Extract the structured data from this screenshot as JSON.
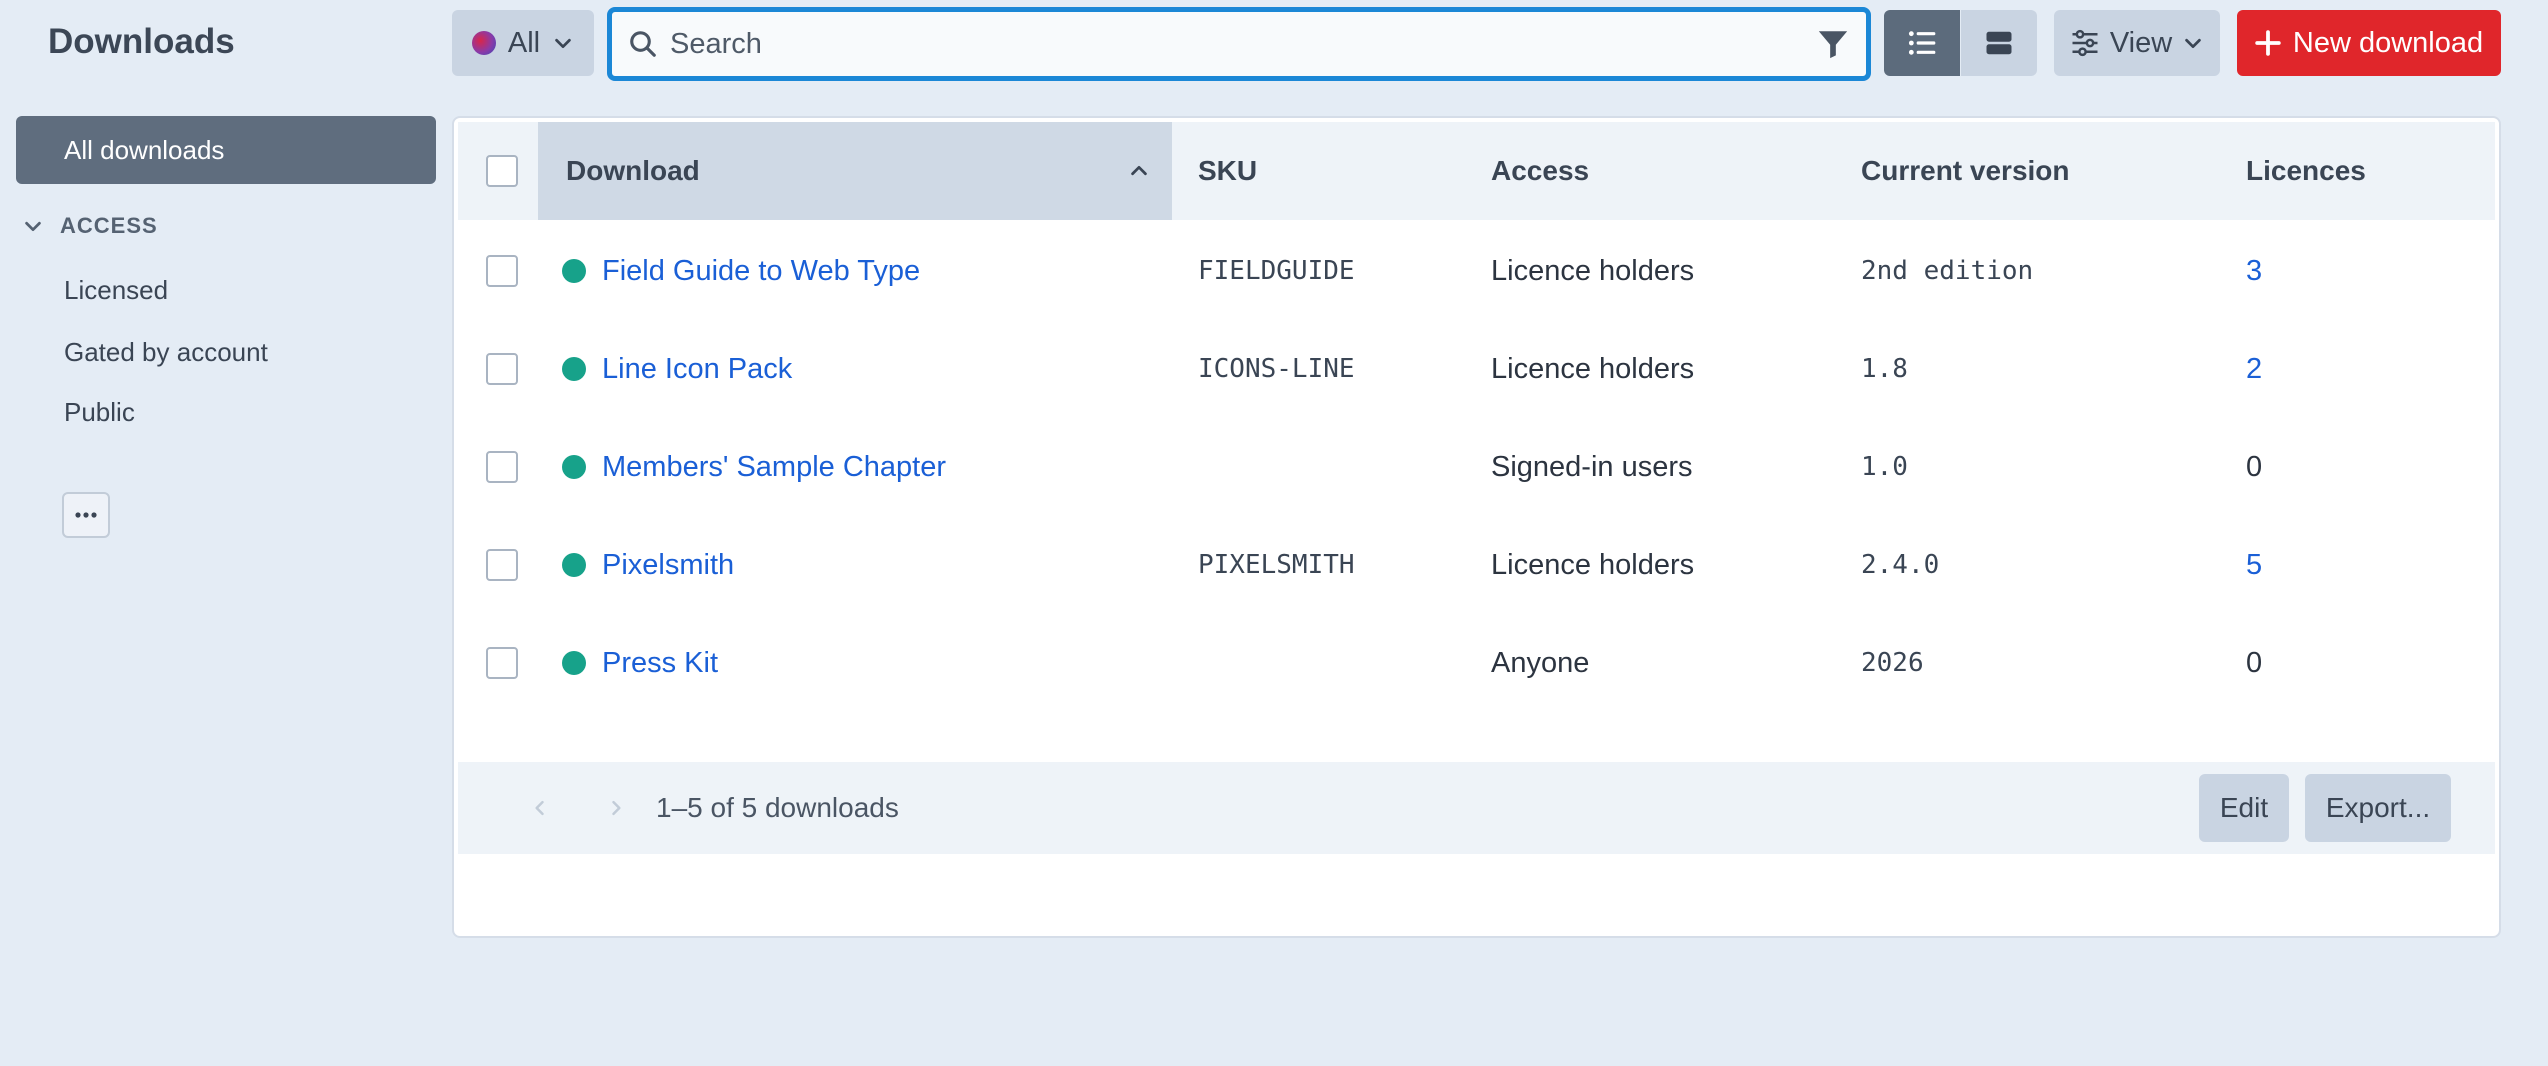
{
  "header": {
    "title": "Downloads",
    "scope_label": "All",
    "search_placeholder": "Search",
    "view_label": "View",
    "new_label": "New download"
  },
  "sidebar": {
    "active_item": "All downloads",
    "group_label": "ACCESS",
    "items": [
      {
        "label": "Licensed"
      },
      {
        "label": "Gated by account"
      },
      {
        "label": "Public"
      }
    ]
  },
  "table": {
    "columns": [
      "Download",
      "SKU",
      "Access",
      "Current version",
      "Licences"
    ],
    "rows": [
      {
        "name": "Field Guide to Web Type",
        "sku": "FIELDGUIDE",
        "access": "Licence holders",
        "version": "2nd edition",
        "licences": "3",
        "licences_link": true
      },
      {
        "name": "Line Icon Pack",
        "sku": "ICONS-LINE",
        "access": "Licence holders",
        "version": "1.8",
        "licences": "2",
        "licences_link": true
      },
      {
        "name": "Members' Sample Chapter",
        "sku": "",
        "access": "Signed-in users",
        "version": "1.0",
        "licences": "0",
        "licences_link": false
      },
      {
        "name": "Pixelsmith",
        "sku": "PIXELSMITH",
        "access": "Licence holders",
        "version": "2.4.0",
        "licences": "5",
        "licences_link": true
      },
      {
        "name": "Press Kit",
        "sku": "",
        "access": "Anyone",
        "version": "2026",
        "licences": "0",
        "licences_link": false
      }
    ]
  },
  "footer": {
    "range_text": "1–5 of 5 downloads",
    "edit_label": "Edit",
    "export_label": "Export..."
  },
  "colors": {
    "accent": "#1b87d6",
    "primary_action": "#e0262b",
    "status_active": "#17a28a",
    "link": "#1a5fd6"
  }
}
